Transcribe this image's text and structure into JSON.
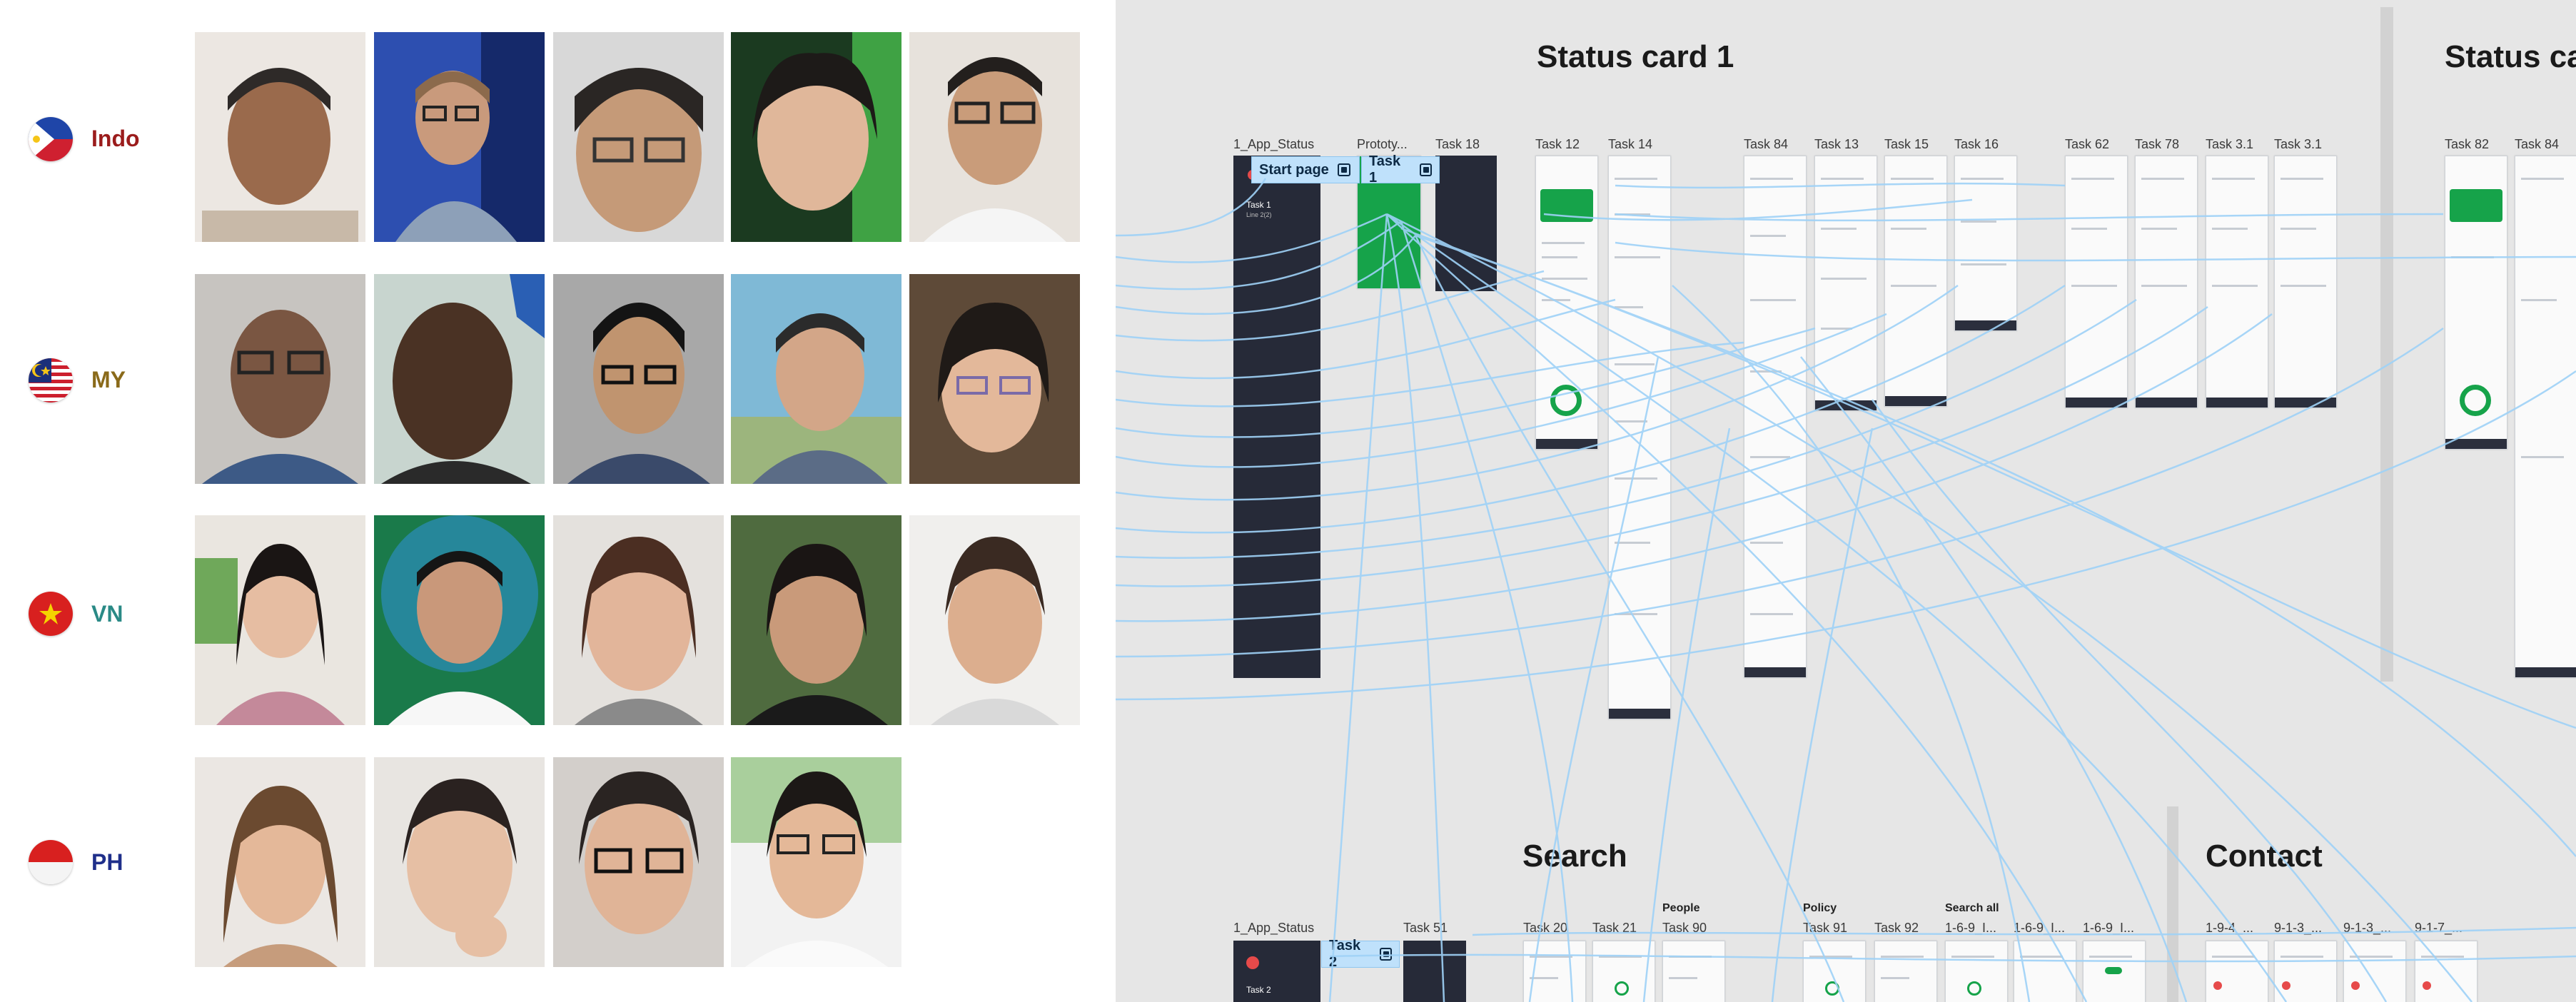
{
  "participants": {
    "groups": [
      {
        "code": "Indo",
        "flag": "philippines-flag-icon",
        "color": "#9b1c1c"
      },
      {
        "code": "MY",
        "flag": "malaysia-flag-icon",
        "color": "#8a6a1a"
      },
      {
        "code": "VN",
        "flag": "vietnam-flag-icon",
        "color": "#2a8a86"
      },
      {
        "code": "PH",
        "flag": "indonesia-flag-icon",
        "color": "#1f2f8a"
      }
    ],
    "photo_counts": [
      5,
      5,
      5,
      4
    ]
  },
  "canvas": {
    "sections": {
      "status_card_1": "Status card 1",
      "status_card_2": "Status ca",
      "search": "Search",
      "contact": "Contact"
    },
    "frame_labels_top": [
      "1_App_Status",
      "Prototy...",
      "Task 18",
      "Task 12",
      "Task 14",
      "Task 84",
      "Task 13",
      "Task 15",
      "Task 16",
      "Task 62",
      "Task 78",
      "Task 3.1",
      "Task 3.1",
      "Task 82",
      "Task 84"
    ],
    "frame_labels_bottom": [
      "1_App_Status",
      "Task 51",
      "Task 20",
      "Task 21",
      "Task 90",
      "Task 91",
      "Task 92",
      "1-6-9_I...",
      "1-6-9_I...",
      "1-6-9_I...",
      "1-9-4_...",
      "9-1-3_...",
      "9-1-3_...",
      "9-1-7_..."
    ],
    "group_labels": {
      "people": "People",
      "policy": "Policy",
      "search_all": "Search all"
    },
    "prototype_flows": {
      "start_page": "Start page",
      "task_1": "Task 1",
      "task_2": "Task 2"
    },
    "dark_frame_text": {
      "task_1": "Task 1",
      "task_1_sub": "Line 2(2)",
      "task_2": "Task 2"
    },
    "accent_color": "#9fd2f7"
  }
}
